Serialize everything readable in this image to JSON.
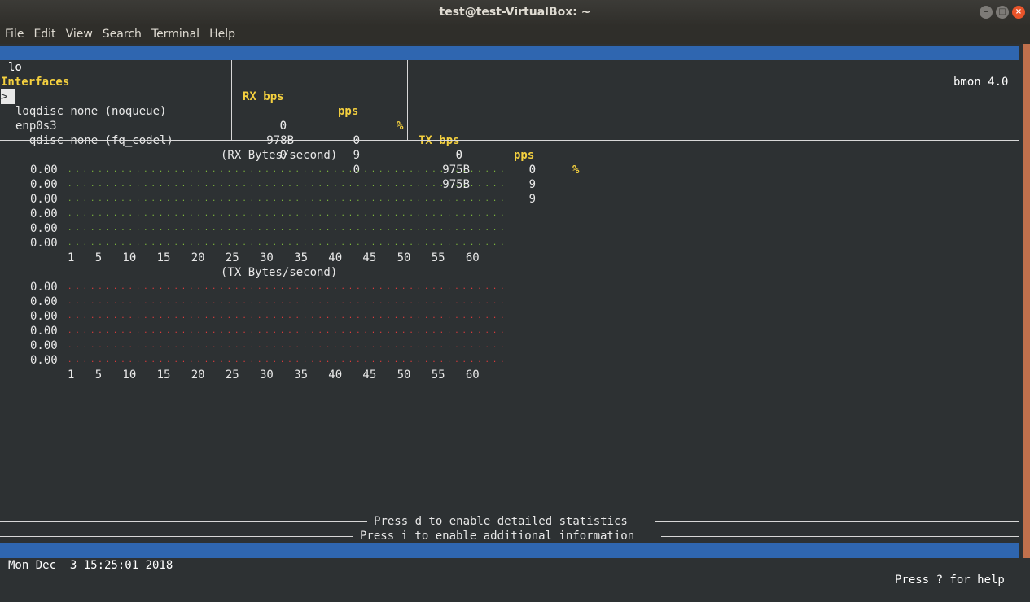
{
  "window": {
    "title": "test@test-VirtualBox: ~",
    "buttons": [
      "–",
      "□",
      "×"
    ]
  },
  "menu": [
    "File",
    "Edit",
    "View",
    "Search",
    "Terminal",
    "Help"
  ],
  "statusbar_top": {
    "left": "lo",
    "right": "bmon 4.0"
  },
  "table": {
    "headers": {
      "interfaces": "Interfaces",
      "rx_bps": "RX bps",
      "rx_pps": "pps",
      "rx_pct": "%",
      "tx_bps": "TX bps",
      "tx_pps": "pps",
      "tx_pct": "%"
    },
    "rows": [
      {
        "name": "lo",
        "rx_bps": "0",
        "rx_pps": "0",
        "tx_bps": "0",
        "tx_pps": "0",
        "selected": true
      },
      {
        "name": "  qdisc none (noqueue)",
        "rx_bps": "0",
        "rx_pps": "0",
        "tx_bps": "0",
        "tx_pps": "0"
      },
      {
        "name": "enp0s3",
        "rx_bps": "978B",
        "rx_pps": "9",
        "tx_bps": "975B",
        "tx_pps": "9"
      },
      {
        "name": "  qdisc none (fq_codel)",
        "rx_bps": "0",
        "rx_pps": "0",
        "tx_bps": "975B",
        "tx_pps": "9"
      }
    ],
    "cursor_glyph": ">"
  },
  "graphs": [
    {
      "title": "(RX Bytes/second)",
      "y_labels": [
        "0.00",
        "0.00",
        "0.00",
        "0.00",
        "0.00",
        "0.00"
      ],
      "x_labels": "1   5   10   15   20   25   30   35   40   45   50   55   60",
      "color": "#7eb83c"
    },
    {
      "title": "(TX Bytes/second)",
      "y_labels": [
        "0.00",
        "0.00",
        "0.00",
        "0.00",
        "0.00",
        "0.00"
      ],
      "x_labels": "1   5   10   15   20   25   30   35   40   45   50   55   60",
      "color": "#e03b3b"
    }
  ],
  "hints": {
    "detailed": "Press d to enable detailed statistics",
    "info": "Press i to enable additional information"
  },
  "statusbar_bottom": {
    "left": "Mon Dec  3 15:25:01 2018",
    "right": "Press ? for help"
  }
}
